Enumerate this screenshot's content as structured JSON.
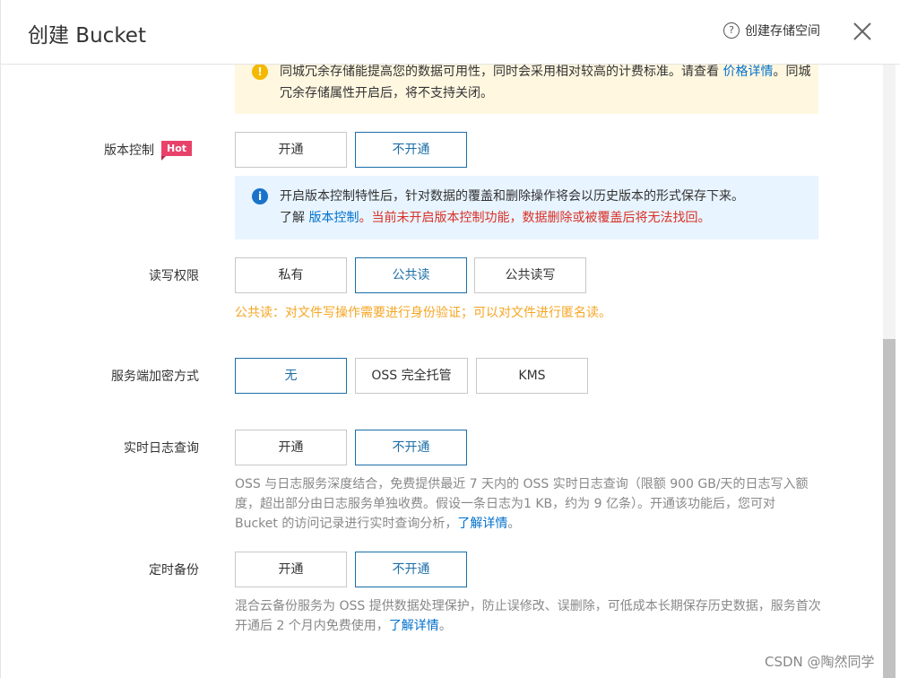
{
  "dialog": {
    "title": "创建 Bucket",
    "help_label": "创建存储空间"
  },
  "redundancy_alert": {
    "text": "同城冗余存储能提高您的数据可用性，同时会采用相对较高的计费标准。请查看 ",
    "link": "价格详情",
    "text2": "。同城冗余存储属性开启后，将不支持关闭。"
  },
  "versioning": {
    "label": "版本控制",
    "badge": "Hot",
    "options": [
      "开通",
      "不开通"
    ],
    "selected": "不开通",
    "info_line1": "开启版本控制特性后，针对数据的覆盖和删除操作将会以历史版本的形式保存下来。",
    "info_prefix": "了解 ",
    "info_link": "版本控制",
    "info_warning": "。当前未开启版本控制功能，数据删除或被覆盖后将无法找回。"
  },
  "acl": {
    "label": "读写权限",
    "options": [
      "私有",
      "公共读",
      "公共读写"
    ],
    "selected": "公共读",
    "note": "公共读：对文件写操作需要进行身份验证；可以对文件进行匿名读。"
  },
  "encryption": {
    "label": "服务端加密方式",
    "options": [
      "无",
      "OSS 完全托管",
      "KMS"
    ],
    "selected": "无"
  },
  "realtime_log": {
    "label": "实时日志查询",
    "options": [
      "开通",
      "不开通"
    ],
    "selected": "不开通",
    "note": "OSS 与日志服务深度结合，免费提供最近 7 天内的 OSS 实时日志查询（限额 900 GB/天的日志写入额度，超出部分由日志服务单独收费。假设一条日志为1 KB，约为 9 亿条）。开通该功能后，您可对 Bucket 的访问记录进行实时查询分析，",
    "link": "了解详情",
    "suffix": "。"
  },
  "backup": {
    "label": "定时备份",
    "options": [
      "开通",
      "不开通"
    ],
    "selected": "不开通",
    "note": "混合云备份服务为 OSS 提供数据处理保护，防止误修改、误删除，可低成本长期保存历史数据，服务首次开通后 2 个月内免费使用，",
    "link": "了解详情",
    "suffix": "。"
  },
  "watermark": "CSDN @陶然同学",
  "colors": {
    "selected_border": "#1c6ea8",
    "warn_bg": "#fff7e0",
    "info_bg": "#e8f4ff",
    "link": "#0070cc",
    "danger": "#d93026",
    "note_orange": "#f5a623"
  }
}
